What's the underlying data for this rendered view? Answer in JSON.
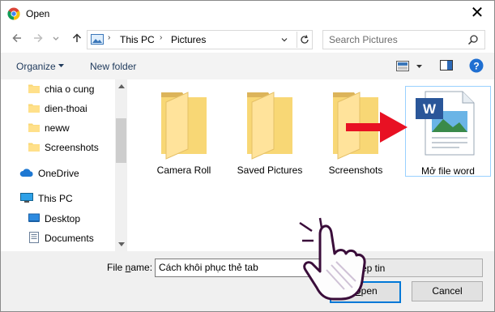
{
  "window": {
    "title": "Open",
    "close_glyph": "✕"
  },
  "nav": {
    "back_icon": "arrow-left-icon",
    "forward_icon": "arrow-right-icon",
    "recent_icon": "chevron-down-icon",
    "up_icon": "arrow-up-icon",
    "breadcrumbs": [
      "This PC",
      "Pictures"
    ],
    "search_placeholder": "Search Pictures"
  },
  "toolbar": {
    "organize_label": "Organize",
    "new_folder_label": "New folder"
  },
  "sidebar": {
    "items": [
      {
        "label": "chia o cung",
        "icon": "folder-icon"
      },
      {
        "label": "dien-thoai",
        "icon": "folder-icon"
      },
      {
        "label": "neww",
        "icon": "folder-icon"
      },
      {
        "label": "Screenshots",
        "icon": "folder-icon"
      },
      {
        "label": "OneDrive",
        "icon": "cloud-icon"
      },
      {
        "label": "This PC",
        "icon": "computer-icon"
      },
      {
        "label": "Desktop",
        "icon": "desktop-icon"
      },
      {
        "label": "Documents",
        "icon": "documents-icon"
      }
    ]
  },
  "files": [
    {
      "name": "Camera Roll",
      "type": "folder"
    },
    {
      "name": "Saved Pictures",
      "type": "folder"
    },
    {
      "name": "Screenshots",
      "type": "folder"
    },
    {
      "name": "Mở file word",
      "type": "word-document",
      "selected": true
    }
  ],
  "footer": {
    "file_name_label_prefix": "File ",
    "file_name_label_underline": "n",
    "file_name_label_suffix": "ame:",
    "file_name_value": "Cách khôi phục thẻ tab",
    "file_type_value": "ệp tin",
    "open_label_underline": "O",
    "open_label_rest": "pen",
    "cancel_label": "Cancel"
  },
  "colors": {
    "accent": "#0078d7",
    "link": "#1e395b",
    "folder": "#f8d775",
    "arrow": "#e81123"
  }
}
